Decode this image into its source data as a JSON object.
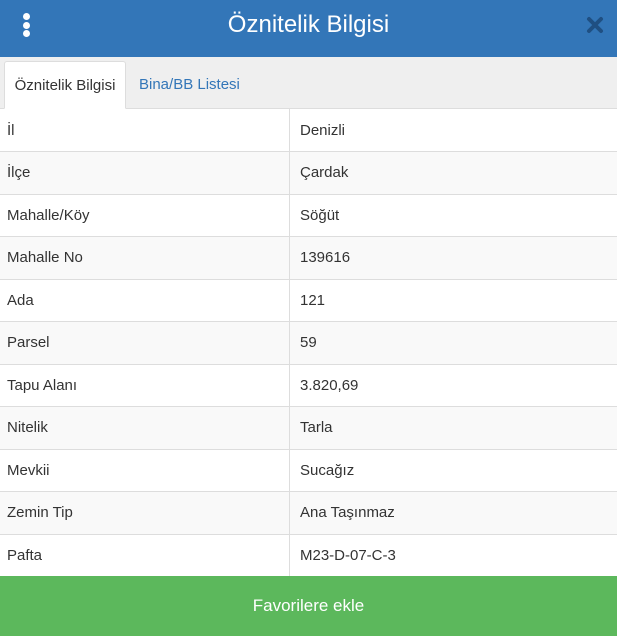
{
  "header": {
    "title": "Öznitelik Bilgisi",
    "menu_icon": "kebab-vertical-icon",
    "close_icon": "close-icon",
    "background": "#3376b8"
  },
  "tabs": [
    {
      "label": "Öznitelik Bilgisi",
      "active": true
    },
    {
      "label": "Bina/BB Listesi",
      "active": false
    }
  ],
  "attributes": [
    {
      "key": "İl",
      "value": "Denizli"
    },
    {
      "key": "İlçe",
      "value": "Çardak"
    },
    {
      "key": "Mahalle/Köy",
      "value": "Söğüt"
    },
    {
      "key": "Mahalle No",
      "value": "139616"
    },
    {
      "key": "Ada",
      "value": "121"
    },
    {
      "key": "Parsel",
      "value": "59"
    },
    {
      "key": "Tapu Alanı",
      "value": "3.820,69"
    },
    {
      "key": "Nitelik",
      "value": "Tarla"
    },
    {
      "key": "Mevkii",
      "value": "Sucağız"
    },
    {
      "key": "Zemin Tip",
      "value": "Ana Taşınmaz"
    },
    {
      "key": "Pafta",
      "value": "M23-D-07-C-3"
    }
  ],
  "footer": {
    "button_label": "Favorilere ekle",
    "color": "#5cb85c"
  }
}
